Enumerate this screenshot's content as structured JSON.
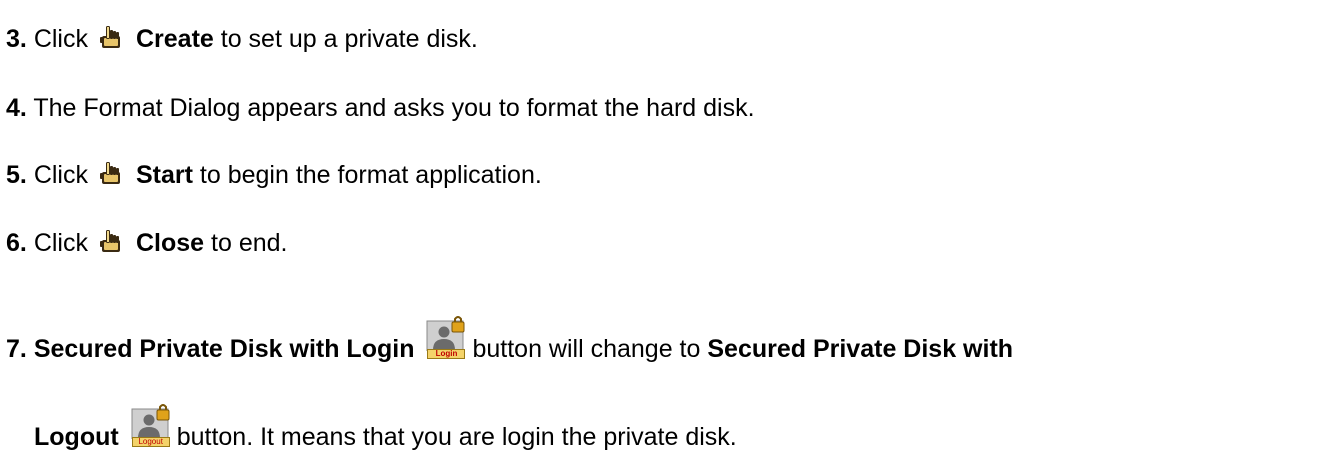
{
  "steps": [
    {
      "num": "3.",
      "pre": "Click",
      "bold": "Create",
      "post": "to set up a private disk."
    },
    {
      "num": "4.",
      "text": "The Format Dialog appears and asks you to format the hard disk."
    },
    {
      "num": "5.",
      "pre": "Click",
      "bold": "Start",
      "post": "to begin the format application."
    },
    {
      "num": "6.",
      "pre": "Click",
      "bold": "Close",
      "post": "to end."
    },
    {
      "num": "7.",
      "bold_a": "Secured Private Disk with Login",
      "mid": "button will change to",
      "bold_b": "Secured Private Disk with",
      "bold_c": "Logout",
      "post": "button. It means that you are login the private disk."
    }
  ],
  "icons": {
    "hand": "hand-click-icon",
    "login": "private-disk-login-icon",
    "logout": "private-disk-logout-icon",
    "login_tag": "Login",
    "logout_tag": "Logout"
  },
  "colors": {
    "text": "#000000",
    "tag_bg": "#f4d36a",
    "tag_text": "#c00000"
  }
}
